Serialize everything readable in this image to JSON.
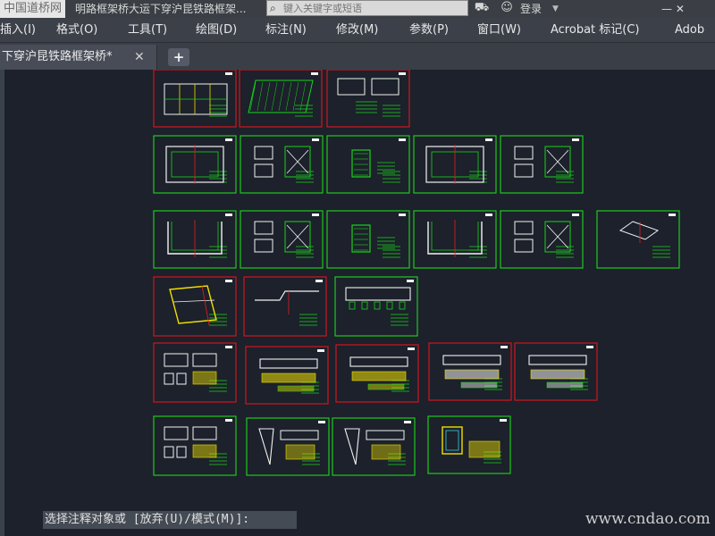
{
  "titlebar": {
    "site_logo": "中国道桥网",
    "file_title": "明路框架桥大运下穿沪昆铁路框架...",
    "search_placeholder": "键入关键字或短语",
    "login_label": "登录",
    "login_caret": "▼",
    "window_controls": "—  ✕"
  },
  "menubar": {
    "items": [
      "插入(I)",
      "格式(O)",
      "工具(T)",
      "绘图(D)",
      "标注(N)",
      "修改(M)",
      "参数(P)",
      "窗口(W)",
      "Acrobat 标记(C)",
      "Adob"
    ]
  },
  "tabs": {
    "active_label": "下穿沪昆铁路框架桥*",
    "close_glyph": "✕",
    "new_tab_glyph": "+"
  },
  "colors": {
    "green_frame": "#1ec81e",
    "red_frame": "#d0161e",
    "background": "#1c212b"
  },
  "sheets": [
    {
      "row": 0,
      "frame": "red",
      "content": "grid-plan"
    },
    {
      "row": 0,
      "frame": "red",
      "content": "hatched-plan"
    },
    {
      "row": 0,
      "frame": "red",
      "content": "section-notes"
    },
    {
      "row": 1,
      "frame": "green",
      "content": "box-section"
    },
    {
      "row": 1,
      "frame": "green",
      "content": "rebar-detail"
    },
    {
      "row": 1,
      "frame": "green",
      "content": "notes-sheet"
    },
    {
      "row": 1,
      "frame": "green",
      "content": "box-section"
    },
    {
      "row": 1,
      "frame": "green",
      "content": "rebar-detail"
    },
    {
      "row": 2,
      "frame": "green",
      "content": "u-section"
    },
    {
      "row": 2,
      "frame": "green",
      "content": "rebar-detail"
    },
    {
      "row": 2,
      "frame": "green",
      "content": "notes-sheet"
    },
    {
      "row": 2,
      "frame": "green",
      "content": "u-section"
    },
    {
      "row": 2,
      "frame": "green",
      "content": "rebar-detail"
    },
    {
      "row": 2,
      "frame": "green",
      "content": "elevation-small"
    },
    {
      "row": 3,
      "frame": "red",
      "content": "skew-plan"
    },
    {
      "row": 3,
      "frame": "red",
      "content": "profile"
    },
    {
      "row": 3,
      "frame": "green",
      "content": "long-elevation"
    },
    {
      "row": 4,
      "frame": "red",
      "content": "mixed-details"
    },
    {
      "row": 4,
      "frame": "red",
      "content": "elevation-table"
    },
    {
      "row": 4,
      "frame": "red",
      "content": "elevation-table"
    },
    {
      "row": 4,
      "frame": "red",
      "content": "elevation-table-white"
    },
    {
      "row": 4,
      "frame": "red",
      "content": "elevation-table-white"
    },
    {
      "row": 5,
      "frame": "green",
      "content": "mixed-details"
    },
    {
      "row": 5,
      "frame": "green",
      "content": "wing-wall"
    },
    {
      "row": 5,
      "frame": "green",
      "content": "wing-wall"
    },
    {
      "row": 5,
      "frame": "green",
      "content": "yellow-plan"
    }
  ],
  "command": {
    "prompt": "选择注释对象或 [放弃(U)/模式(M)]:"
  },
  "footer": {
    "watermark": "www.cndao.com"
  }
}
